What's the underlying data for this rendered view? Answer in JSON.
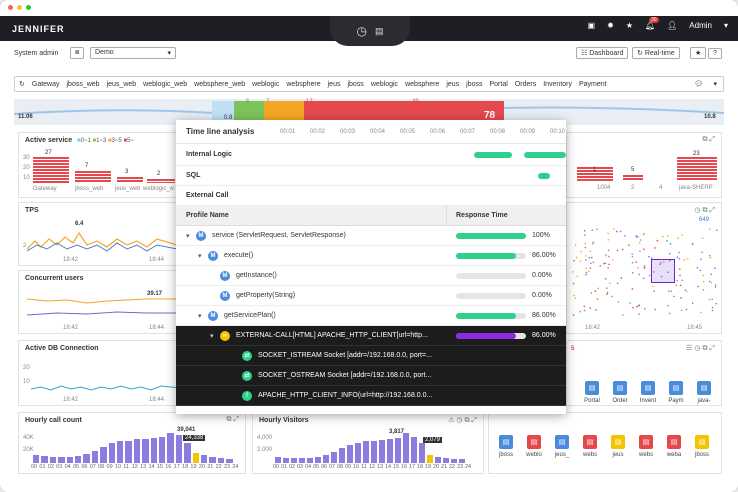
{
  "topbar": {
    "logo": "JENNIFER",
    "notif_count": "30",
    "user": "Admin"
  },
  "toolbar": {
    "system": "System admin",
    "domain": "Demo",
    "dashboard": "Dashboard",
    "realtime": "Real-time"
  },
  "instances": [
    "Gateway",
    "jboss_web",
    "jeus_web",
    "weblogic_web",
    "websphere_web",
    "weblogic",
    "websphere",
    "jeus",
    "jboss",
    "weblogic",
    "websphere",
    "jeus",
    "jboss",
    "Portal",
    "Orders",
    "Inventory",
    "Payment"
  ],
  "strip": {
    "left": "11.06",
    "right": "10.8",
    "nums": [
      "5",
      "7",
      "17",
      "49",
      "78"
    ],
    "mid": "0.8"
  },
  "active_service": {
    "title": "Active service",
    "legend": [
      "0~1",
      "1~3",
      "3~5",
      "5~"
    ],
    "y": [
      "30",
      "20",
      "10"
    ],
    "cats": [
      "Gateway",
      "jboss_web",
      "jeus_web",
      "weblogic_w"
    ],
    "vals": [
      "27",
      "7",
      "3",
      "2"
    ],
    "right_vals": [
      "1",
      "5",
      "23"
    ],
    "right_cats": [
      "1004",
      "2",
      "4",
      "java-SHERP"
    ]
  },
  "tps": {
    "title": "TPS",
    "y": [
      "2"
    ],
    "peak": "6.4",
    "x": [
      "18:42",
      "18:44"
    ],
    "right_top": "649"
  },
  "concurrent": {
    "title": "Concurrent users",
    "peak": "39.17",
    "x": [
      "18:42",
      "18:44"
    ],
    "right_x": [
      "18:42",
      "18:45"
    ]
  },
  "db": {
    "title": "Active DB Connection",
    "y": [
      "20",
      "10"
    ],
    "x": [
      "18:42",
      "18:44"
    ]
  },
  "hourly": {
    "title": "Hourly call count",
    "y": [
      "40K",
      "20K"
    ],
    "peak": "39,041",
    "cur": "24,338",
    "x": [
      "00",
      "01",
      "02",
      "03",
      "04",
      "05",
      "06",
      "07",
      "08",
      "09",
      "10",
      "11",
      "12",
      "13",
      "14",
      "15",
      "16",
      "17",
      "18",
      "19",
      "20",
      "21",
      "22",
      "23",
      "24"
    ]
  },
  "visitors": {
    "title": "Hourly Visitors",
    "y": [
      "4,000",
      "2,000"
    ],
    "peak": "3,817",
    "cur": "2,079"
  },
  "timeline": {
    "title": "Time line analysis",
    "ticks": [
      "00:01",
      "00:02",
      "00:03",
      "00:04",
      "00:05",
      "00:06",
      "00:07",
      "00:08",
      "00:09",
      "00:10"
    ],
    "rows": [
      "Internal Logic",
      "SQL",
      "External Call"
    ]
  },
  "profile": {
    "name_header": "Profile Name",
    "time_header": "Response Time",
    "rows": [
      {
        "label": "service (ServletRequest, ServletResponse)",
        "pct": "100%"
      },
      {
        "label": "execute()",
        "pct": "86.00%"
      },
      {
        "label": "getInstance()",
        "pct": "0.00%"
      },
      {
        "label": "getProperty(String)",
        "pct": "0.00%"
      },
      {
        "label": "getServicePlan()",
        "pct": "86.00%"
      },
      {
        "label": "EXTERNAL-CALL[HTML] APACHE_HTTP_CLIENT[url=http...",
        "pct": "86.00%"
      },
      {
        "label": "SOCKET_ISTREAM Socket [addr=/192.168.0.0, port=..."
      },
      {
        "label": "SOCKET_OSTREAM Socket [addr=/192.168.0.0, port..."
      },
      {
        "label": "APACHE_HTTP_CLIENT_INFO(url=http://192.168.0.0..."
      }
    ]
  },
  "apps_row1": [
    "Portal",
    "Order",
    "Invent",
    "Paym",
    "java-"
  ],
  "apps_row2": [
    "jboss",
    "weblo",
    "jeus_",
    "webs",
    "jeus",
    "webs",
    "weba",
    "jboss"
  ],
  "right_badge": "5"
}
